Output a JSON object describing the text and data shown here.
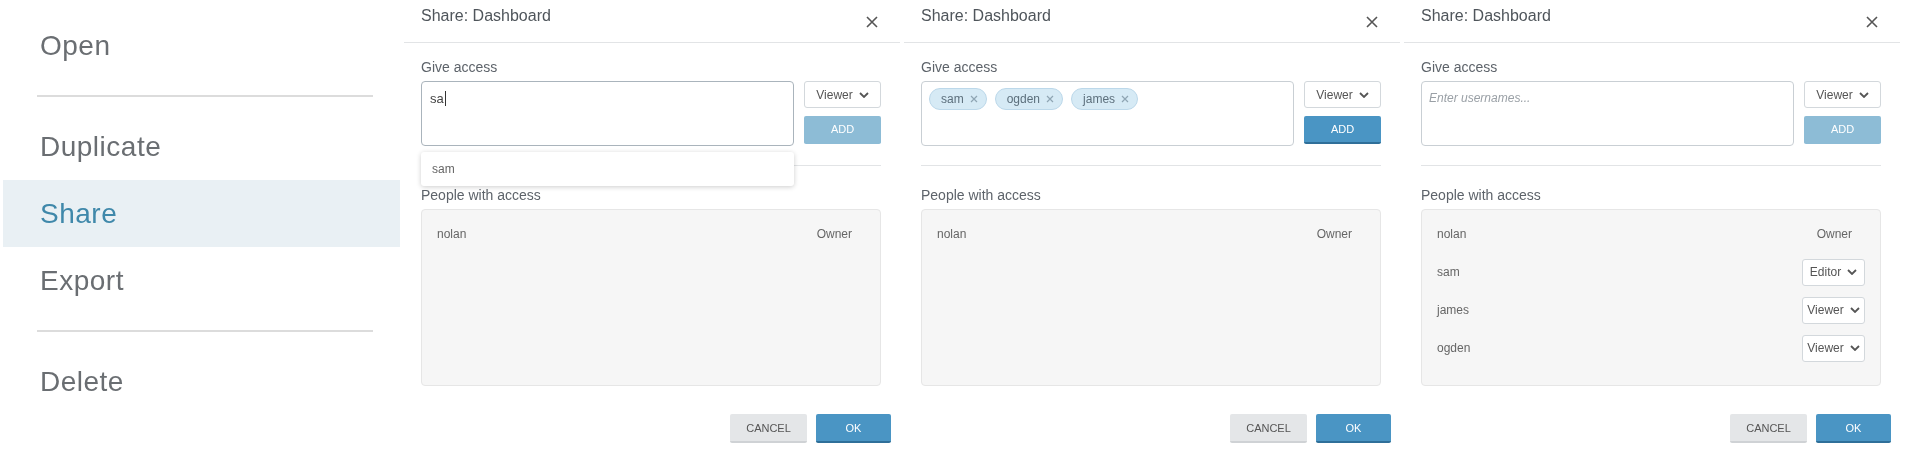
{
  "menu": {
    "items": [
      {
        "kind": "item",
        "label": "Open",
        "selected": false
      },
      {
        "kind": "separator"
      },
      {
        "kind": "item",
        "label": "Duplicate",
        "selected": false
      },
      {
        "kind": "item",
        "label": "Share",
        "selected": true
      },
      {
        "kind": "item",
        "label": "Export",
        "selected": false
      },
      {
        "kind": "separator"
      },
      {
        "kind": "item",
        "label": "Delete",
        "selected": false
      }
    ]
  },
  "dialogs": [
    {
      "title": "Share: Dashboard",
      "give_access_label": "Give access",
      "input": {
        "value": "sa",
        "focused": true
      },
      "role_select": "Viewer",
      "add_button": {
        "label": "ADD",
        "disabled": true
      },
      "suggestions": [
        "sam"
      ],
      "people_label": "People with access",
      "people": [
        {
          "name": "nolan",
          "role": "Owner",
          "kind": "text"
        }
      ],
      "cancel": "CANCEL",
      "ok": "OK"
    },
    {
      "title": "Share: Dashboard",
      "give_access_label": "Give access",
      "input": {
        "tokens": [
          "sam",
          "ogden",
          "james"
        ],
        "focused": false
      },
      "role_select": "Viewer",
      "add_button": {
        "label": "ADD",
        "disabled": false
      },
      "people_label": "People with access",
      "people": [
        {
          "name": "nolan",
          "role": "Owner",
          "kind": "text"
        }
      ],
      "cancel": "CANCEL",
      "ok": "OK"
    },
    {
      "title": "Share: Dashboard",
      "give_access_label": "Give access",
      "input": {
        "placeholder": "Enter usernames...",
        "focused": false
      },
      "role_select": "Viewer",
      "add_button": {
        "label": "ADD",
        "disabled": true
      },
      "people_label": "People with access",
      "people": [
        {
          "name": "nolan",
          "role": "Owner",
          "kind": "text"
        },
        {
          "name": "sam",
          "role": "Editor",
          "kind": "select"
        },
        {
          "name": "james",
          "role": "Viewer",
          "kind": "select"
        },
        {
          "name": "ogden",
          "role": "Viewer",
          "kind": "select"
        }
      ],
      "cancel": "CANCEL",
      "ok": "OK"
    }
  ]
}
